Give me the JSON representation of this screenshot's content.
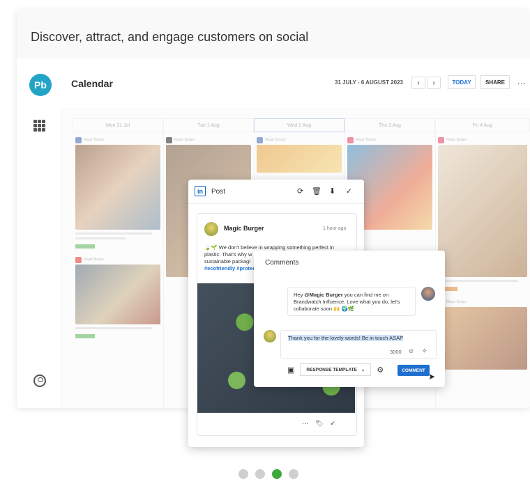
{
  "headline": "Discover, attract, and engage customers on social",
  "brand": {
    "logo_text": "Pb",
    "accent": "#22a4c7"
  },
  "calendar": {
    "title": "Calendar",
    "date_range": "31 JULY - 6 AUGUST 2023",
    "prev": "‹",
    "next": "›",
    "today_label": "TODAY",
    "share_label": "SHARE",
    "more": "..."
  },
  "days": [
    {
      "label": "Mon 31 Jul"
    },
    {
      "label": "Tue 1 Aug"
    },
    {
      "label": "Wed 2 Aug"
    },
    {
      "label": "Thu 3 Aug"
    },
    {
      "label": "Fri 4 Aug"
    }
  ],
  "account_name": "Magic Burger",
  "post_modal": {
    "network_icon": "in",
    "title": "Post",
    "account": "Magic Burger",
    "time": "1 hour ago",
    "text": "🍃🌱 We don't believe in wrapping something perfect in plastic. That's why w",
    "text2": "sustainable packagi",
    "tags": "#ecofriendly #protec",
    "actions": {
      "refresh": "⟳",
      "trash": "🗑",
      "download": "⬇",
      "check": "✓"
    },
    "footer": {
      "more": "···",
      "tag": "🏷",
      "check": "✓"
    }
  },
  "comments": {
    "title": "Comments",
    "incoming_prefix": "Hey ",
    "incoming_mention": "@Magic Burger",
    "incoming_rest": " you can find me on Brandwatch Influence. Love what you do, let's collaborate soon 🙌 🌍🌿",
    "reply_text": "Thank you for the lovely words! Be in touch ASAP",
    "char_count": "3000",
    "template_label": "RESPONSE TEMPLATE",
    "comment_label": "COMMENT"
  },
  "carousel": {
    "count": 4,
    "active_index": 2,
    "active_color": "#3ea83c"
  }
}
